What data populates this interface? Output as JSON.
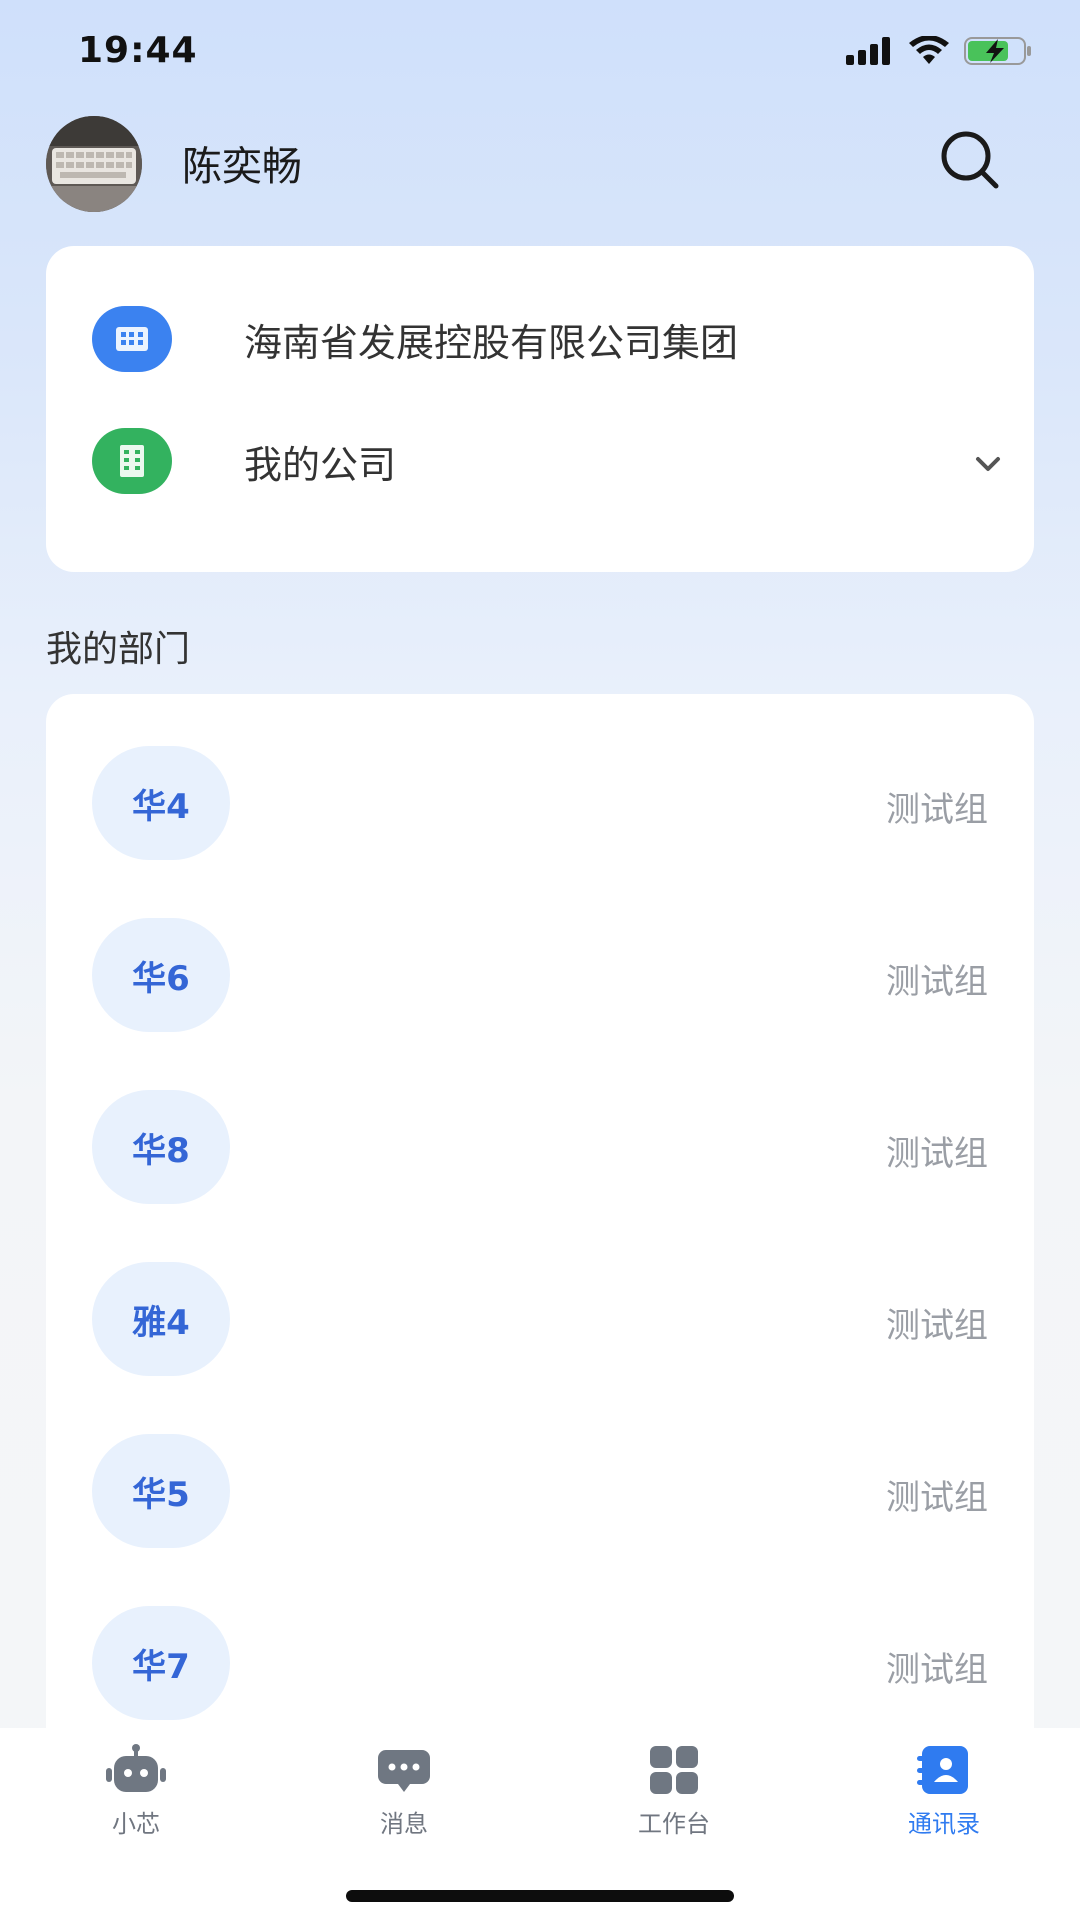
{
  "status_bar": {
    "time": "19:44"
  },
  "header": {
    "user_name": "陈奕畅"
  },
  "organizations": [
    {
      "name": "海南省发展控股有限公司集团",
      "icon": "building-icon",
      "color": "#3b82f0"
    },
    {
      "name": "我的公司",
      "icon": "office-building-icon",
      "color": "#33b25f"
    }
  ],
  "section_title": "我的部门",
  "departments": [
    {
      "avatar_text": "华4",
      "group": "测试组"
    },
    {
      "avatar_text": "华6",
      "group": "测试组"
    },
    {
      "avatar_text": "华8",
      "group": "测试组"
    },
    {
      "avatar_text": "雅4",
      "group": "测试组"
    },
    {
      "avatar_text": "华5",
      "group": "测试组"
    },
    {
      "avatar_text": "华7",
      "group": "测试组"
    }
  ],
  "tabs": [
    {
      "label": "小芯",
      "icon": "robot-icon",
      "active": false
    },
    {
      "label": "消息",
      "icon": "chat-bubble-icon",
      "active": false
    },
    {
      "label": "工作台",
      "icon": "grid-icon",
      "active": false
    },
    {
      "label": "通讯录",
      "icon": "contacts-icon",
      "active": true
    }
  ],
  "colors": {
    "accent": "#2f7bf0",
    "dept_avatar_bg": "#e8f1fd",
    "dept_avatar_text": "#3466d6",
    "muted_text": "#9a9ea5"
  }
}
